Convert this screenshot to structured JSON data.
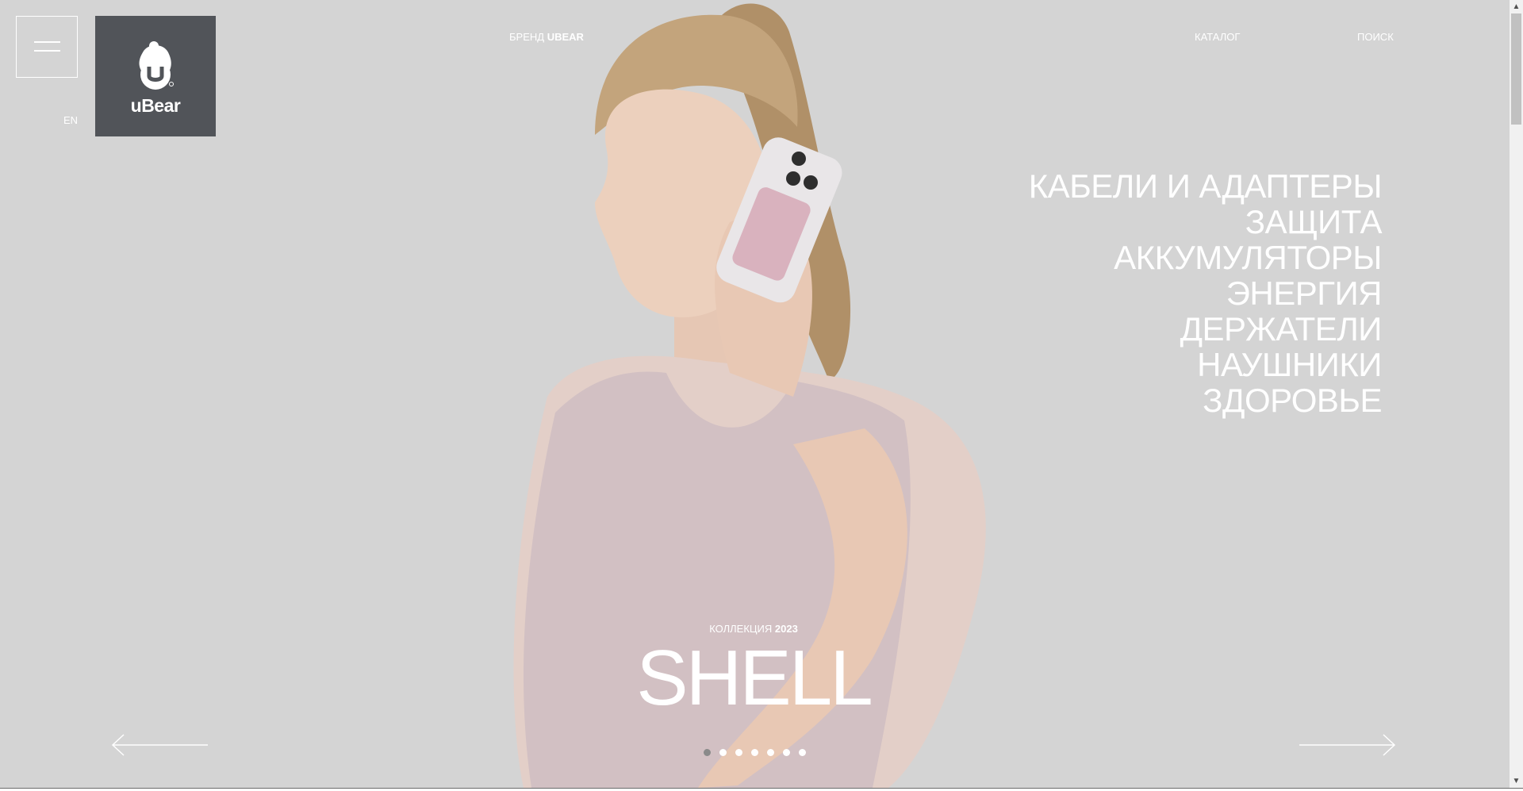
{
  "header": {
    "menu_button_icon": "hamburger-icon",
    "language": "EN",
    "logo": {
      "text": "uBear",
      "icon": "bear-logo-icon",
      "bg_color": "#515459"
    },
    "brand_link": {
      "prefix": "БРЕНД",
      "name": "UBEAR"
    },
    "catalog_link": "КАТАЛОГ",
    "search_link": "ПОИСК"
  },
  "categories": [
    "КАБЕЛИ И АДАПТЕРЫ",
    "ЗАЩИТА",
    "АККУМУЛЯТОРЫ",
    "ЭНЕРГИЯ",
    "ДЕРЖАТЕЛИ",
    "НАУШНИКИ",
    "ЗДОРОВЬЕ"
  ],
  "hero": {
    "collection_label": "КОЛЛЕКЦИЯ",
    "collection_year": "2023",
    "title": "SHELL",
    "image": "woman-with-phone-photo",
    "background_color": "#d4d4d4"
  },
  "slider": {
    "prev_icon": "arrow-left-icon",
    "next_icon": "arrow-right-icon",
    "slide_count": 7,
    "active_slide": 1
  },
  "scrollbar": {
    "up_icon": "scroll-up-icon",
    "down_icon": "scroll-down-icon"
  }
}
